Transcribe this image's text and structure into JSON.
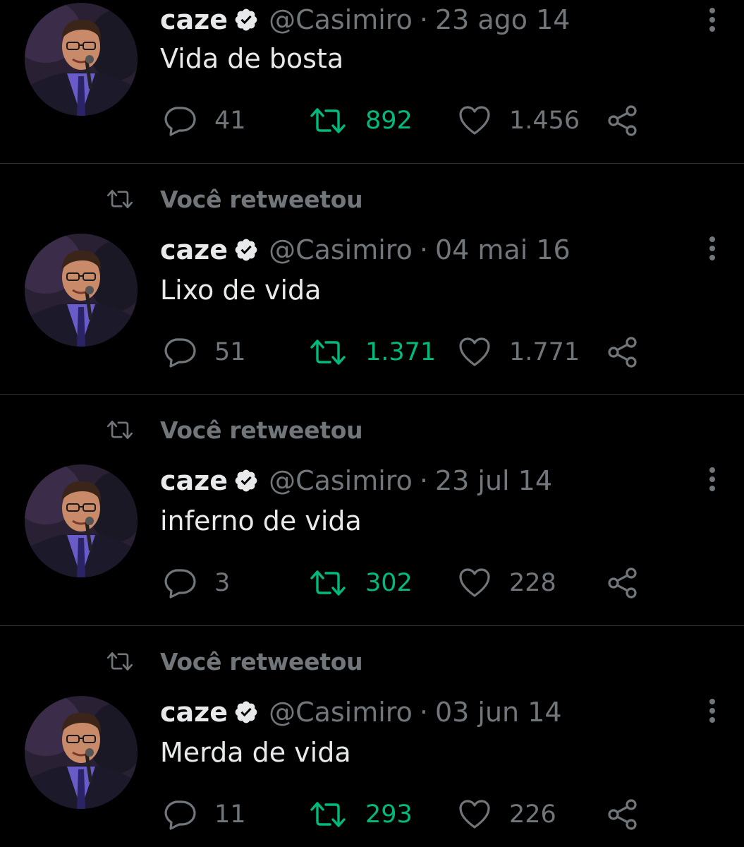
{
  "colors": {
    "background": "#000000",
    "text_primary": "#e7e9ea",
    "text_secondary": "#71767b",
    "retweet_active": "#00ba7c",
    "divider": "#2f3336"
  },
  "icons": {
    "reply": "speech-bubble-icon",
    "retweet": "retweet-arrows-icon",
    "like": "heart-icon",
    "share": "share-nodes-icon",
    "more": "vertical-dots-icon",
    "verified": "verified-badge-icon"
  },
  "tweets": [
    {
      "retweet_label": "",
      "author_name": "caze",
      "author_handle": "@Casimiro",
      "separator": "·",
      "date": "23 ago 14",
      "text": "Vida de bosta",
      "replies": "41",
      "retweets": "892",
      "likes": "1.456"
    },
    {
      "retweet_label": "Você retweetou",
      "author_name": "caze",
      "author_handle": "@Casimiro",
      "separator": "·",
      "date": "04 mai 16",
      "text": "Lixo de vida",
      "replies": "51",
      "retweets": "1.371",
      "likes": "1.771"
    },
    {
      "retweet_label": "Você retweetou",
      "author_name": "caze",
      "author_handle": "@Casimiro",
      "separator": "·",
      "date": "23 jul 14",
      "text": "inferno de vida",
      "replies": "3",
      "retweets": "302",
      "likes": "228"
    },
    {
      "retweet_label": "Você retweetou",
      "author_name": "caze",
      "author_handle": "@Casimiro",
      "separator": "·",
      "date": "03 jun 14",
      "text": "Merda de vida",
      "replies": "11",
      "retweets": "293",
      "likes": "226"
    }
  ]
}
